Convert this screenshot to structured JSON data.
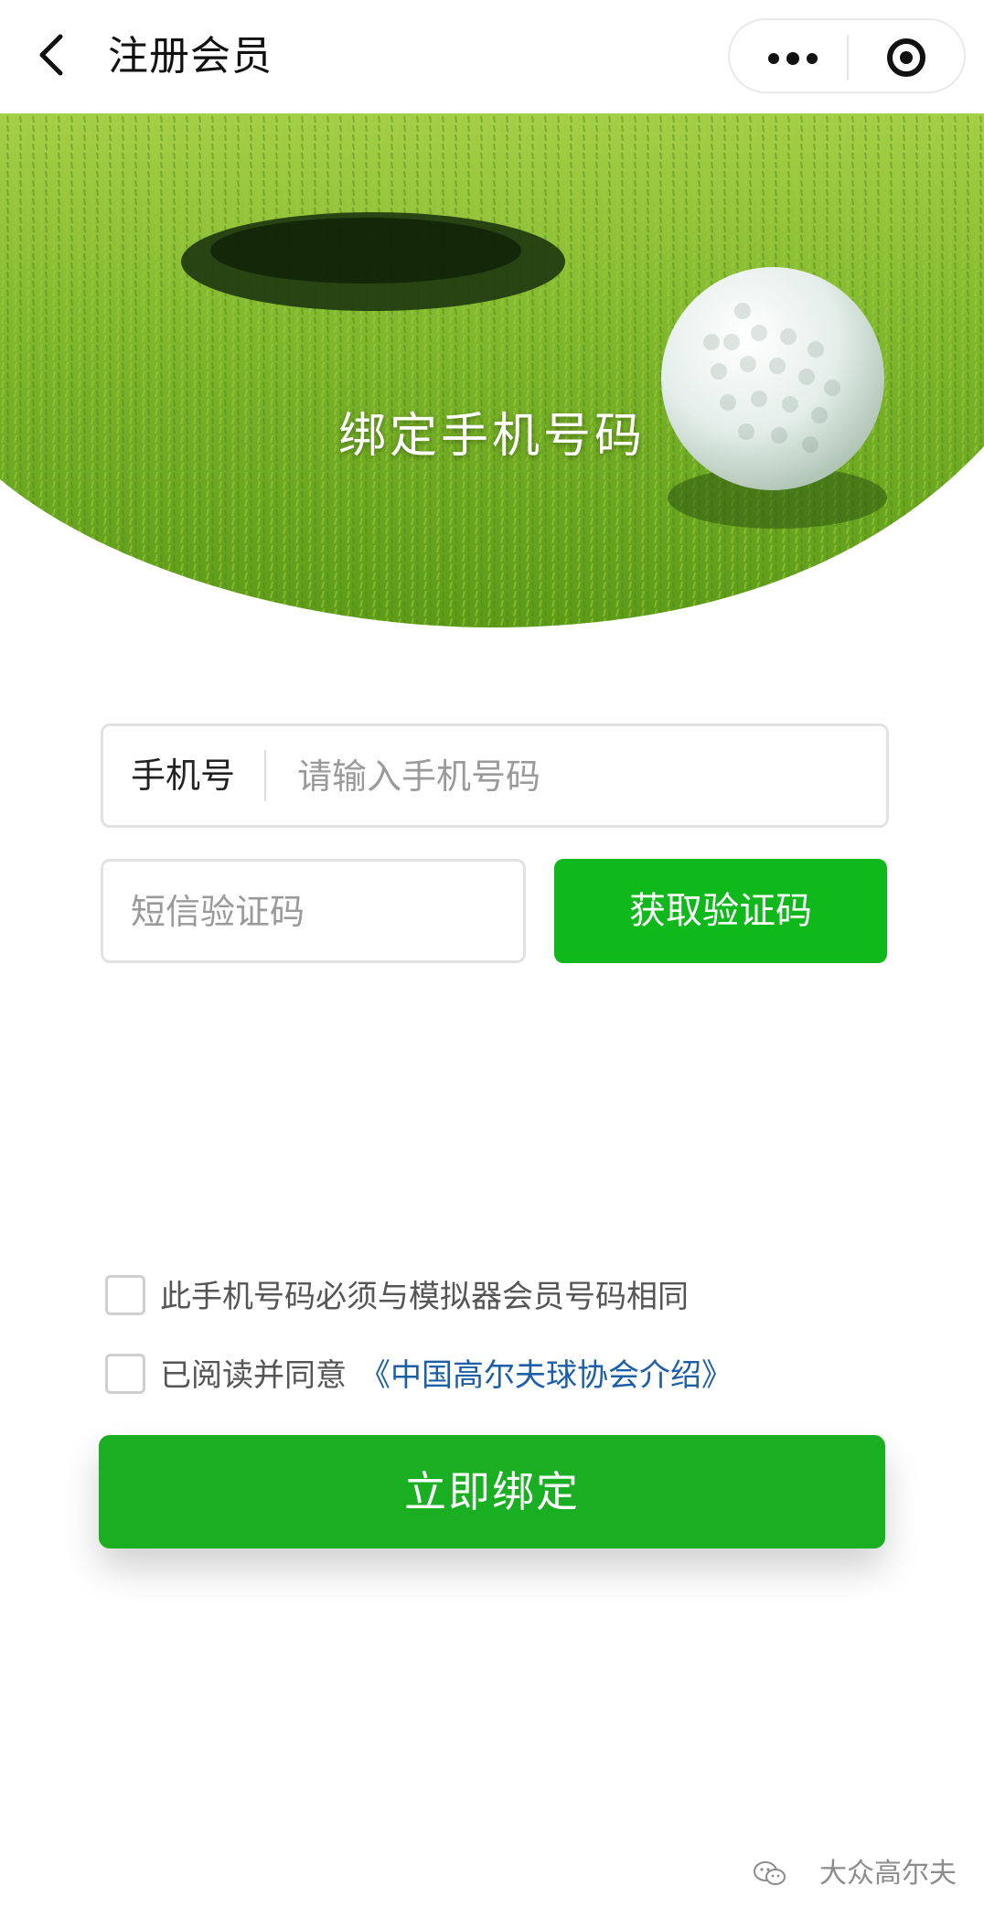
{
  "navbar": {
    "title": "注册会员",
    "icons": {
      "back": "chevron-left-icon",
      "more": "more-dots-icon",
      "close": "target-circle-icon"
    }
  },
  "banner": {
    "title": "绑定手机号码",
    "image": "golf-ball-near-hole-on-green",
    "colors": {
      "grass": "#7ab62a",
      "hole": "#1f3a10",
      "ball": "#e9f0ea"
    }
  },
  "form": {
    "phone_label": "手机号",
    "phone_placeholder": "请输入手机号码",
    "code_placeholder": "短信验证码",
    "get_code_label": "获取验证码"
  },
  "agreements": {
    "same_number_text": "此手机号码必须与模拟器会员号码相同",
    "read_agree_text": "已阅读并同意",
    "agreement_link": "《中国高尔夫球协会介绍》"
  },
  "submit": {
    "label": "立即绑定"
  },
  "watermark": {
    "text": "大众高尔夫",
    "icon": "wechat-icon"
  },
  "colors": {
    "accent": "#10b91b",
    "link": "#1d5fa7",
    "border": "#e2e2e2"
  }
}
